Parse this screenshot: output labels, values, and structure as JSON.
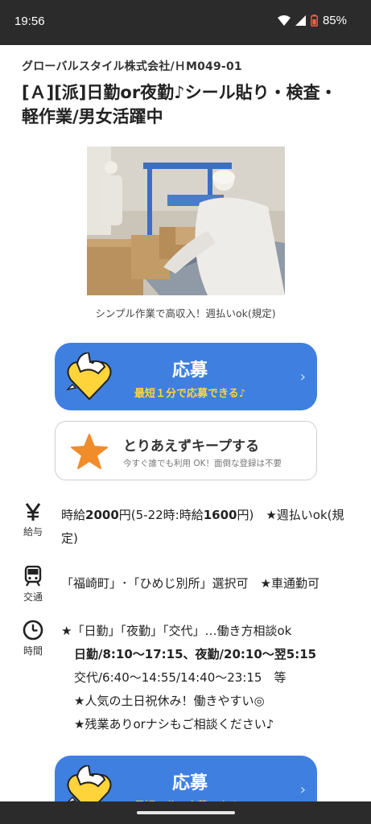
{
  "status_bar": {
    "time": "19:56",
    "battery": "85%"
  },
  "job": {
    "company": "グローバルスタイル株式会社/ＨM049-01",
    "title": "[Ａ][派]日勤or夜勤♪シール貼り・検査・軽作業/男女活躍中",
    "photo_caption": "シンプル作業で高収入！週払いok(規定)"
  },
  "actions": {
    "apply_main": "応募",
    "apply_sub": "最短１分で応募できる♪",
    "keep_main": "とりあえずキープする",
    "keep_sub": "今すぐ誰でも利用 OK！面倒な登録は不要"
  },
  "info": {
    "salary": {
      "label": "給与",
      "p1": "時給",
      "p2": "2000",
      "p3": "円(5-22時:時給",
      "p4": "1600",
      "p5": "円)　★週払いok(規定)"
    },
    "transport": {
      "label": "交通",
      "text": "「福崎町」･「ひめじ別所」選択可　★車通勤可"
    },
    "hours": {
      "label": "時間",
      "line1": "★「日勤」「夜勤」「交代」…働き方相談ok",
      "line2": "日勤/8:10〜17:15、夜勤/20:10〜翌5:15",
      "line3": "交代/6:40〜14:55/14:40〜23:15　等",
      "line4": "★人気の土日祝休み！働きやすい◎",
      "line5": "★残業ありorナシもご相談ください♪"
    }
  },
  "colors": {
    "apply_blue": "#3f7fe0",
    "apply_sub_yellow": "#ffd43b",
    "star_orange": "#f08c2a"
  }
}
